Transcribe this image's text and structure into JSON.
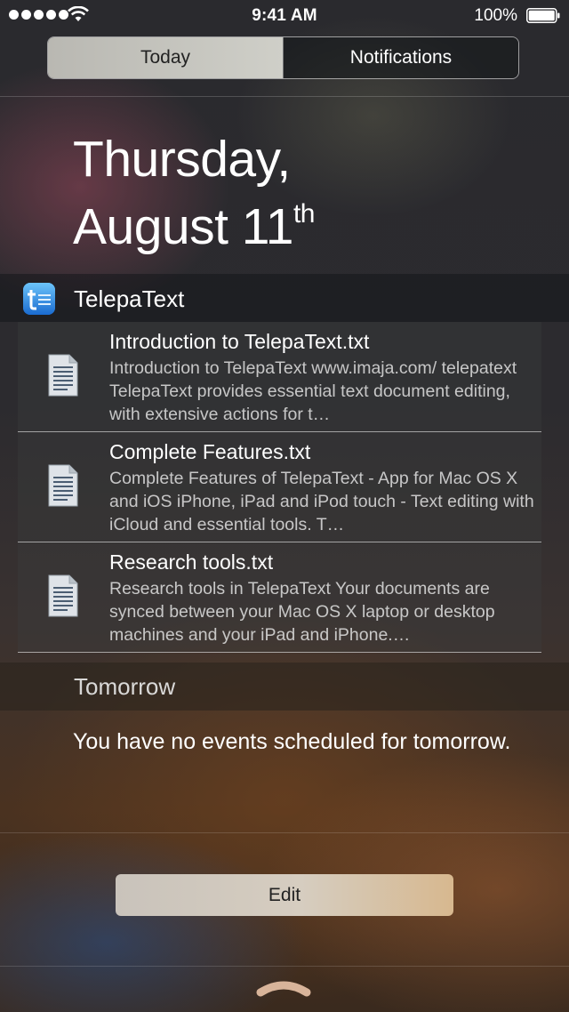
{
  "status_bar": {
    "time": "9:41 AM",
    "battery_percent": "100%",
    "signal_bars": 5,
    "icons": [
      "signal-dots-icon",
      "wifi-icon",
      "battery-icon"
    ]
  },
  "segment": {
    "tabs": [
      {
        "label": "Today",
        "selected": true
      },
      {
        "label": "Notifications",
        "selected": false
      }
    ]
  },
  "date": {
    "weekday": "Thursday,",
    "month_day": "August 11",
    "ordinal_suffix": "th"
  },
  "widget": {
    "app_name": "TelepaText",
    "icon": "telepatext-app-icon",
    "documents": [
      {
        "title": "Introduction to TelepaText.txt",
        "preview": "Introduction to TelepaText www.imaja.com/ telepatext  TelepaText provides essential text document editing, with extensive actions for t…",
        "icon": "document-icon"
      },
      {
        "title": "Complete Features.txt",
        "preview": "Complete Features of TelepaText - App for Mac OS X and iOS iPhone, iPad and iPod touch - Text editing with iCloud and essential tools.  T…",
        "icon": "document-icon"
      },
      {
        "title": "Research tools.txt",
        "preview": "Research tools in TelepaText  Your documents are synced between your Mac OS X laptop or desktop machines and your iPad and iPhone.…",
        "icon": "document-icon"
      }
    ]
  },
  "tomorrow": {
    "title": "Tomorrow",
    "message": "You have no events scheduled for tomorrow."
  },
  "edit_button": {
    "label": "Edit"
  },
  "colors": {
    "segment_selected_bg": "#c4c3bc",
    "app_icon_gradient": [
      "#5bb8f6",
      "#1b6fd1"
    ],
    "edit_button_gradient": [
      "#c9c3bb",
      "#d7b88f"
    ]
  }
}
